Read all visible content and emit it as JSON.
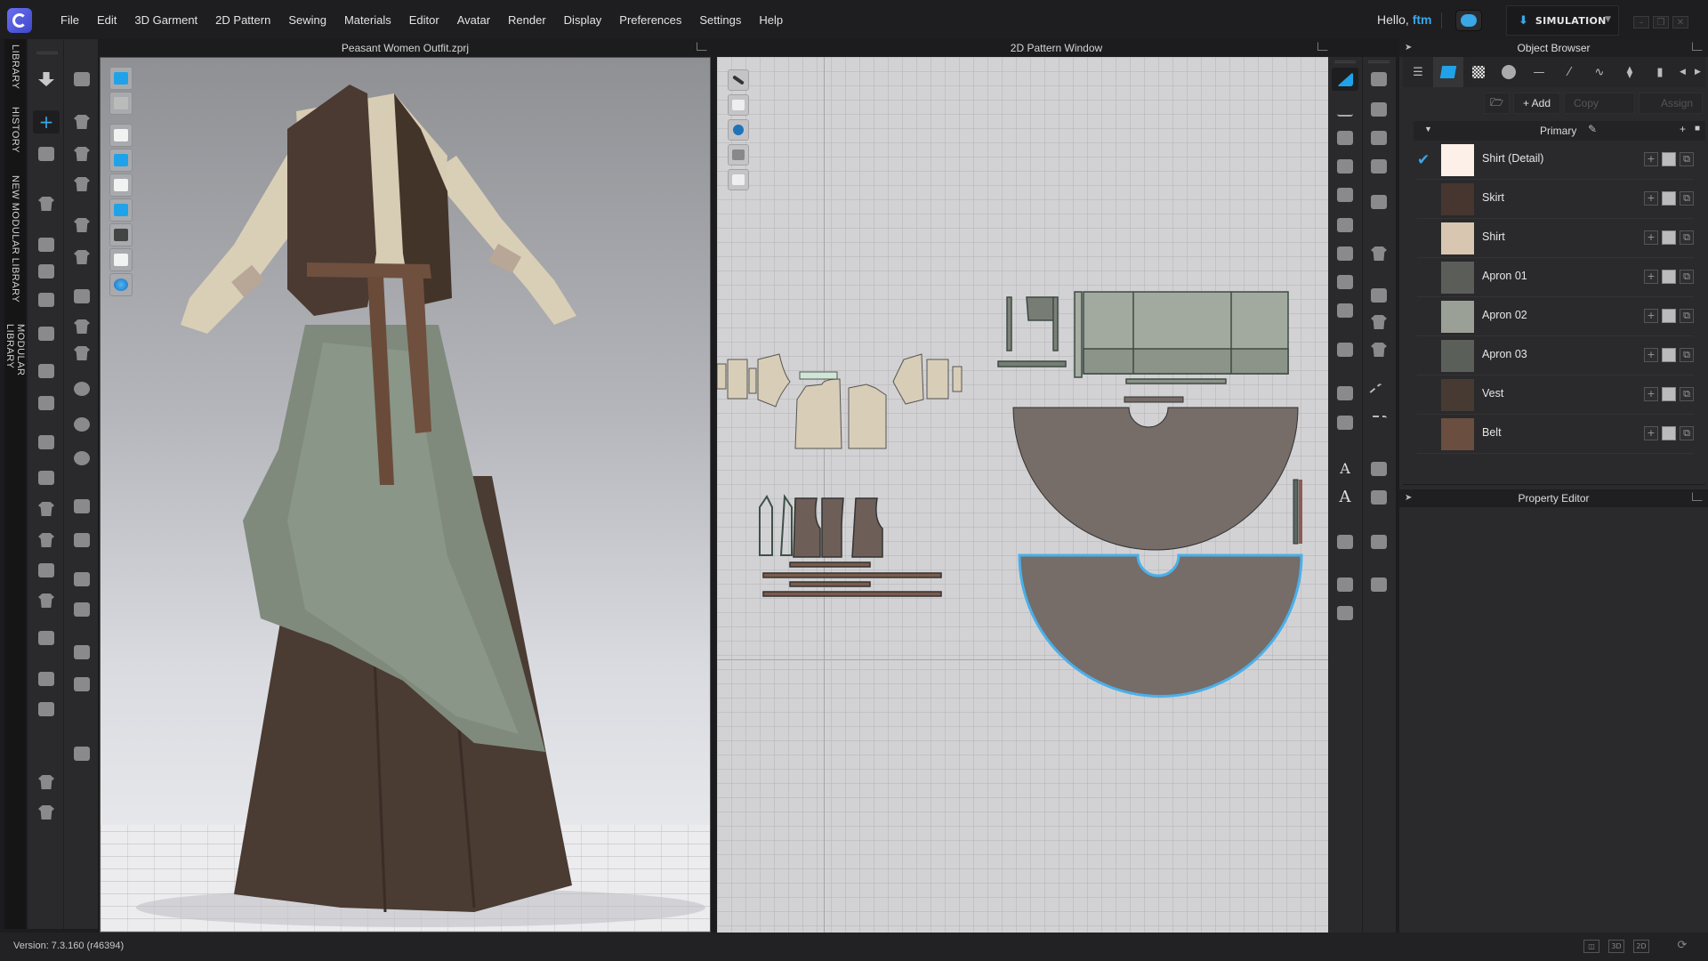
{
  "app": {
    "menu": [
      "File",
      "Edit",
      "3D Garment",
      "2D Pattern",
      "Sewing",
      "Materials",
      "Editor",
      "Avatar",
      "Render",
      "Display",
      "Preferences",
      "Settings",
      "Help"
    ],
    "greeting_prefix": "Hello,",
    "username": "ftm",
    "mode": "SIMULATION"
  },
  "left_tabs": [
    "LIBRARY",
    "HISTORY",
    "NEW MODULAR LIBRARY",
    "MODULAR LIBRARY"
  ],
  "viewport3d": {
    "title": "Peasant Women Outfit.zprj"
  },
  "viewport2d": {
    "title": "2D Pattern Window"
  },
  "object_browser": {
    "title": "Object Browser",
    "tabs": [
      "list-icon",
      "fabric-icon",
      "graphic-icon",
      "button-icon",
      "topstitch-icon",
      "seam-taping-icon",
      "puckering-icon",
      "bow-icon",
      "zipper-icon"
    ],
    "actions": {
      "add": "+ Add",
      "copy": "Copy",
      "assign": "Assign"
    },
    "group": "Primary",
    "fabrics": [
      {
        "name": "Shirt (Detail)",
        "color": "#fcf0e8",
        "selected": true
      },
      {
        "name": "Skirt",
        "color": "#46362f",
        "selected": false
      },
      {
        "name": "Shirt",
        "color": "#d8c6b0",
        "selected": false
      },
      {
        "name": "Apron 01",
        "color": "#5a5d58",
        "selected": false
      },
      {
        "name": "Apron 02",
        "color": "#9ba097",
        "selected": false
      },
      {
        "name": "Apron 03",
        "color": "#5b5f5a",
        "selected": false
      },
      {
        "name": "Vest",
        "color": "#463a33",
        "selected": false
      },
      {
        "name": "Belt",
        "color": "#6a4e3f",
        "selected": false
      }
    ]
  },
  "property_editor": {
    "title": "Property Editor"
  },
  "status": {
    "version": "Version: 7.3.160 (r46394)",
    "view_buttons": [
      "split-view",
      "3D",
      "2D"
    ]
  },
  "colors": {
    "accent": "#3aa7e6",
    "selection_outline": "#4ab0ea"
  }
}
